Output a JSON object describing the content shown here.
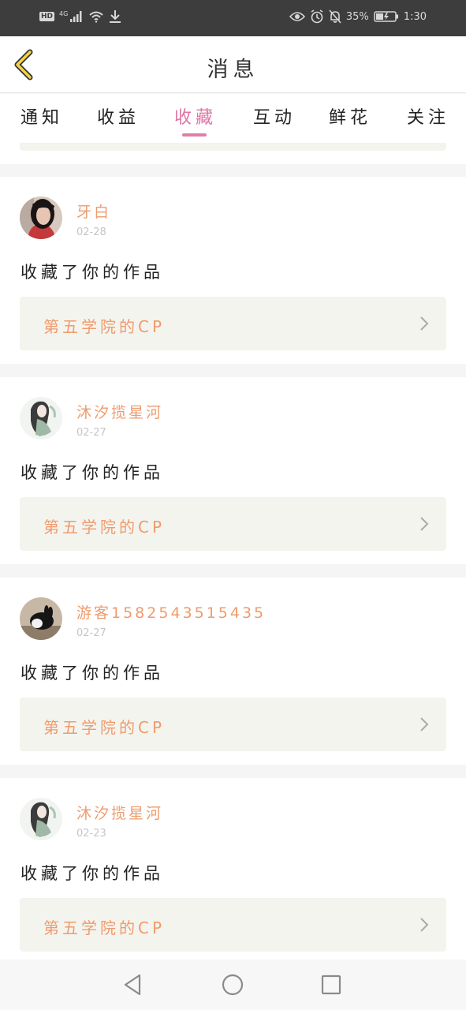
{
  "status_bar": {
    "hd": "HD",
    "network": "4G",
    "battery_percent": "35%",
    "time": "1:30",
    "icons": [
      "signal-icon",
      "wifi-icon",
      "download-icon",
      "eye-icon",
      "alarm-icon",
      "bell-off-icon",
      "battery-icon"
    ]
  },
  "header": {
    "title": "消息",
    "back_icon": "chevron-left-icon"
  },
  "tabs": [
    {
      "label": "通知"
    },
    {
      "label": "收益"
    },
    {
      "label": "收藏",
      "active": true
    },
    {
      "label": "互动"
    },
    {
      "label": "鲜花"
    },
    {
      "label": "关注"
    }
  ],
  "items": [
    {
      "user": "牙白",
      "date": "02-28",
      "action": "收藏了你的作品",
      "work": "第五学院的CP"
    },
    {
      "user": "沐汐揽星河",
      "date": "02-27",
      "action": "收藏了你的作品",
      "work": "第五学院的CP"
    },
    {
      "user": "游客1582543515435",
      "date": "02-27",
      "action": "收藏了你的作品",
      "work": "第五学院的CP"
    },
    {
      "user": "沐汐揽星河",
      "date": "02-23",
      "action": "收藏了你的作品",
      "work": "第五学院的CP"
    }
  ],
  "nav": {
    "back": "triangle-back-icon",
    "home": "circle-home-icon",
    "recent": "square-recent-icon"
  },
  "colors": {
    "accent": "#ef9b6d",
    "tab_active": "#dd75a4",
    "card_bg": "#f4f4ee"
  }
}
